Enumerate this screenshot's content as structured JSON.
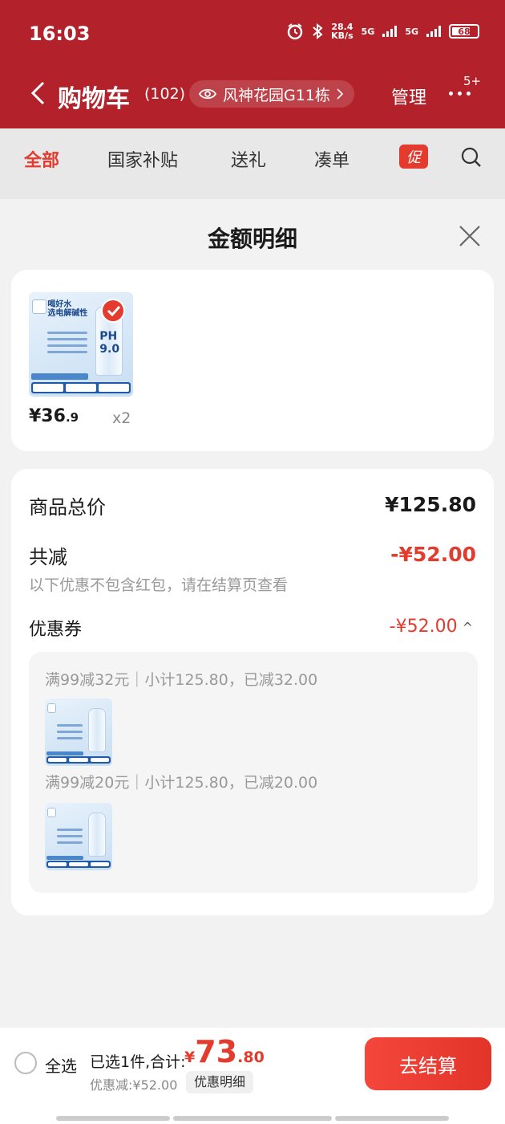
{
  "status": {
    "time": "16:03",
    "speed_value": "28.4",
    "speed_unit": "KB/s",
    "sim1": "5G",
    "sim2": "5G",
    "battery": "68"
  },
  "nav": {
    "title": "购物车",
    "count": "(102)",
    "address": "风神花园G11栋",
    "manage": "管理",
    "more_badge": "5+"
  },
  "tabs": [
    {
      "label": "全部"
    },
    {
      "label": "国家补贴"
    },
    {
      "label": "送礼"
    },
    {
      "label": "凑单"
    }
  ],
  "promo_tag": "促",
  "sheet": {
    "title": "金额明细"
  },
  "goods": {
    "price_main": "¥36",
    "price_decimal": ".9",
    "quantity": "x2",
    "image_title": "喝好水\n选电解碱性",
    "image_ph": "PH 9.0"
  },
  "detail": {
    "total_label": "商品总价",
    "total_value": "¥125.80",
    "reduce_label": "共减",
    "reduce_value": "-¥52.00",
    "note": "以下优惠不包含红包，请在结算页查看",
    "coupon_label": "优惠券",
    "coupon_value": "-¥52.00",
    "coupons": [
      {
        "text": "满99减32元｜小计125.80，已减32.00"
      },
      {
        "text": "满99减20元｜小计125.80，已减20.00"
      }
    ]
  },
  "bottom": {
    "select_all": "全选",
    "selected": "已选1件,合计:",
    "currency": "¥",
    "total_int": "73",
    "total_dec": ".80",
    "discount": "优惠减:¥52.00",
    "detail_btn": "优惠明细",
    "checkout": "去结算"
  },
  "colors": {
    "header_red": "#b3222a",
    "accent_red": "#e33b2e"
  }
}
